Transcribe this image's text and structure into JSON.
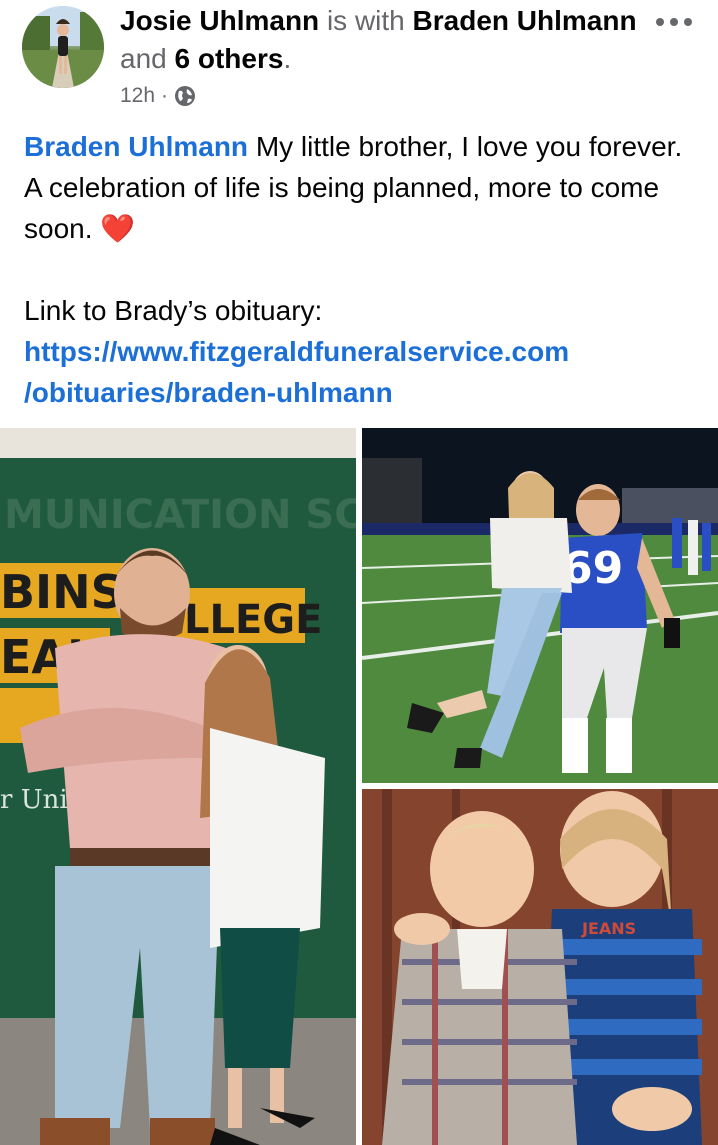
{
  "post": {
    "author": "Josie Uhlmann",
    "with_text": "is with",
    "tagged": "Braden Uhlmann",
    "and_text": "and",
    "others": "6 others",
    "period": ".",
    "timestamp": "12h",
    "separator": "·",
    "audience_icon": "globe-icon",
    "more_icon": "more-horizontal-icon",
    "body": {
      "mention": "Braden Uhlmann",
      "line1": "My little brother, I love you forever. A celebration of life is being planned, more to come soon.",
      "emoji": "❤️",
      "line2": "Link to Brady’s obituary:",
      "link_line1": "https://www.fitzgeraldfuneralservice.com",
      "link_line2": "/obituaries/braden-uhlmann"
    },
    "photos": {
      "left": {
        "sign_lines": [
          "MUNICATION SCIE",
          "BINS",
          "OLLEGE",
          "EAL",
          "r Univ"
        ]
      },
      "top_right": {
        "jersey_number": "69"
      },
      "bottom_right": {
        "shirt_text": "JEANS"
      }
    }
  },
  "colors": {
    "link": "#1b6fd6",
    "secondary_text": "#65676b",
    "heart": "#e8203a"
  }
}
